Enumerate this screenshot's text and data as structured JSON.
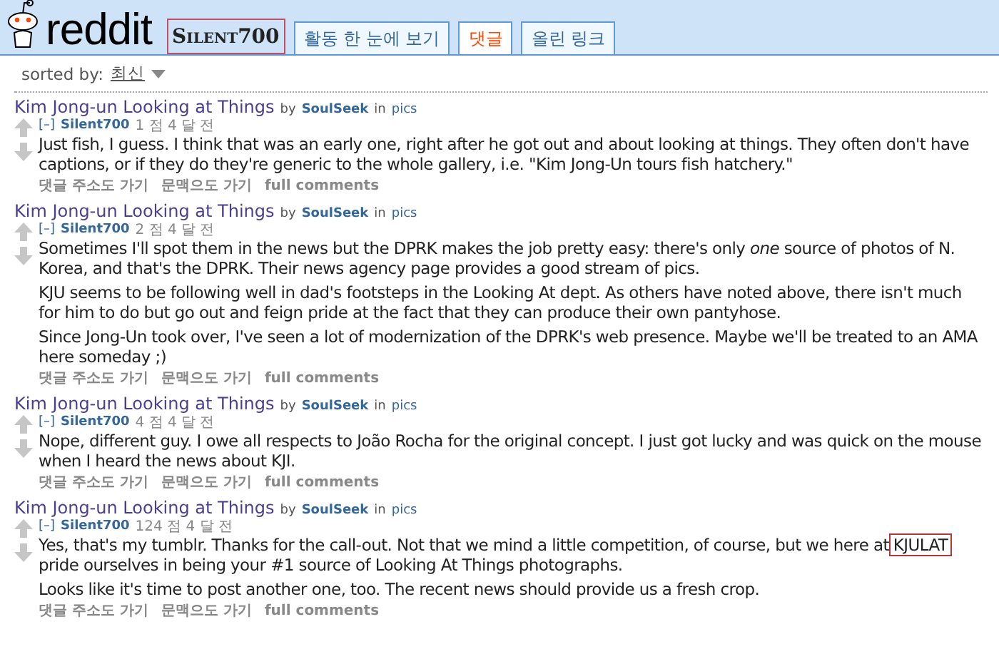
{
  "header": {
    "logo": "reddit",
    "username": "Silent700",
    "username_highlighted": true,
    "tabs": [
      {
        "label": "활동 한 눈에 보기",
        "selected": false
      },
      {
        "label": "댓글",
        "selected": true
      },
      {
        "label": "올린 링크",
        "selected": false
      }
    ]
  },
  "sort": {
    "label": "sorted by:",
    "value": "최신"
  },
  "comments": [
    {
      "title": "Kim Jong-un Looking at Things",
      "by": "by",
      "author": "SoulSeek",
      "in": "in",
      "subreddit": "pics",
      "collapse": "[–]",
      "user": "Silent700",
      "meta": "1 점 4 달 전",
      "paragraphs": [
        {
          "text": "Just fish, I guess. I think that was an early one, right after he got out and about looking at things. They often don't have captions, or if they do they're generic to the whole gallery, i.e. \"Kim Jong-Un tours fish hatchery.\""
        }
      ],
      "actions": [
        "댓글 주소도 가기",
        "문맥으도 가기",
        "full comments"
      ]
    },
    {
      "title": "Kim Jong-un Looking at Things",
      "by": "by",
      "author": "SoulSeek",
      "in": "in",
      "subreddit": "pics",
      "collapse": "[–]",
      "user": "Silent700",
      "meta": "2 점 4 달 전",
      "paragraphs": [
        {
          "text": "Sometimes I'll spot them in the news but the DPRK makes the job pretty easy: there's only *one* source of photos of N. Korea, and that's the DPRK. Their news agency page provides a good stream of pics."
        },
        {
          "text": "KJU seems to be following well in dad's footsteps in the Looking At dept. As others have noted above, there isn't much for him to do but go out and feign pride at the fact that they can produce their own pantyhose."
        },
        {
          "text": "Since Jong-Un took over, I've seen a lot of modernization of the DPRK's web presence. Maybe we'll be treated to an AMA here someday ;)"
        }
      ],
      "actions": [
        "댓글 주소도 가기",
        "문맥으도 가기",
        "full comments"
      ]
    },
    {
      "title": "Kim Jong-un Looking at Things",
      "by": "by",
      "author": "SoulSeek",
      "in": "in",
      "subreddit": "pics",
      "collapse": "[–]",
      "user": "Silent700",
      "meta": "4 점 4 달 전",
      "paragraphs": [
        {
          "text": "Nope, different guy. I owe all respects to João Rocha for the original concept. I just got lucky and was quick on the mouse when I heard the news about KJI."
        }
      ],
      "actions": [
        "댓글 주소도 가기",
        "문맥으도 가기",
        "full comments"
      ]
    },
    {
      "title": "Kim Jong-un Looking at Things",
      "by": "by",
      "author": "SoulSeek",
      "in": "in",
      "subreddit": "pics",
      "collapse": "[–]",
      "user": "Silent700",
      "meta": "124 점 4 달 전",
      "paragraphs": [
        {
          "text": "Yes, that's my tumblr. Thanks for the call-out. Not that we mind a little competition, of course, but we here at",
          "highlight": "KJULAT",
          "after": "pride ourselves in being your #1 source of Looking At Things photographs."
        },
        {
          "text": "Looks like it's time to post another one, too. The recent news should provide us a fresh crop."
        }
      ],
      "actions": [
        "댓글 주소도 가기",
        "문맥으도 가기",
        "full comments"
      ]
    }
  ]
}
